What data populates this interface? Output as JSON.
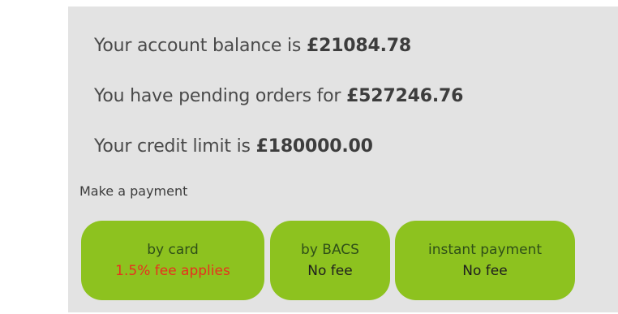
{
  "account": {
    "balance_prefix": "Your account balance is ",
    "balance_value": "£21084.78",
    "pending_prefix": "You have pending orders for ",
    "pending_value": "£527246.76",
    "credit_prefix": "Your credit limit is ",
    "credit_value": "£180000.00"
  },
  "payment": {
    "heading": "Make a payment",
    "options": [
      {
        "method": "by card",
        "fee": "1.5% fee applies"
      },
      {
        "method": "by BACS",
        "fee": "No fee"
      },
      {
        "method": "instant payment",
        "fee": "No fee"
      }
    ]
  },
  "colors": {
    "panel_background": "#e3e3e3",
    "button_green": "#8dc21f",
    "fee_warning_red": "#e8311e"
  }
}
